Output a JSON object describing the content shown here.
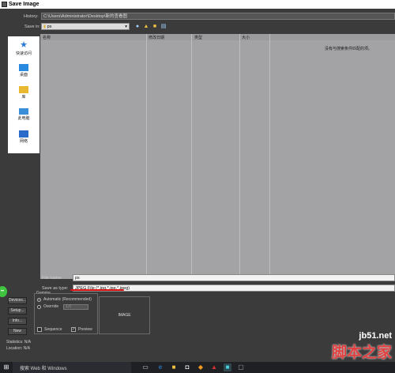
{
  "window": {
    "title": "Save Image"
  },
  "history": {
    "label": "History:",
    "value": "C:\\Users\\Administrator\\Desktop\\新的查看图"
  },
  "save_in": {
    "label": "Save in:",
    "value": "ps"
  },
  "places": [
    {
      "label": "快速访问",
      "icon": "star-icon"
    },
    {
      "label": "桌面",
      "icon": "desktop-icon"
    },
    {
      "label": "库",
      "icon": "library-icon"
    },
    {
      "label": "此电脑",
      "icon": "computer-icon"
    },
    {
      "label": "网络",
      "icon": "network-icon"
    }
  ],
  "file_list": {
    "columns": [
      "名称",
      "修改日期",
      "类型",
      "大小"
    ],
    "empty_message": "没有与搜索条件匹配的项。"
  },
  "file_name": {
    "label": "File name:",
    "value": "ps"
  },
  "save_as_type": {
    "label": "Save as type:",
    "value": "JPEG File (*.jpg,*.jpe,*.jpeg)"
  },
  "side_buttons": [
    "Devices...",
    "Setup...",
    "Info...",
    "New"
  ],
  "gamma": {
    "title": "Gamma",
    "automatic_label": "Automatic (Recommended)",
    "override_label": "Override",
    "override_value": "1.0",
    "selected": "automatic"
  },
  "options": {
    "sequence_label": "Sequence",
    "sequence_checked": false,
    "preview_label": "Preview",
    "preview_checked": true
  },
  "preview_box": {
    "label": "IMAGE"
  },
  "statistics": {
    "label": "Statistics:",
    "value": "N/A"
  },
  "location": {
    "label": "Location:",
    "value": "N/A"
  },
  "taskbar": {
    "search_placeholder": "搜索 Web 和 Windows"
  },
  "watermark": {
    "top": "jb51.net",
    "bottom": "脚本之家"
  },
  "colors": {
    "dialog_bg": "#3b3b3b",
    "list_bg": "#a3a3a6",
    "highlight": "#e01414"
  }
}
